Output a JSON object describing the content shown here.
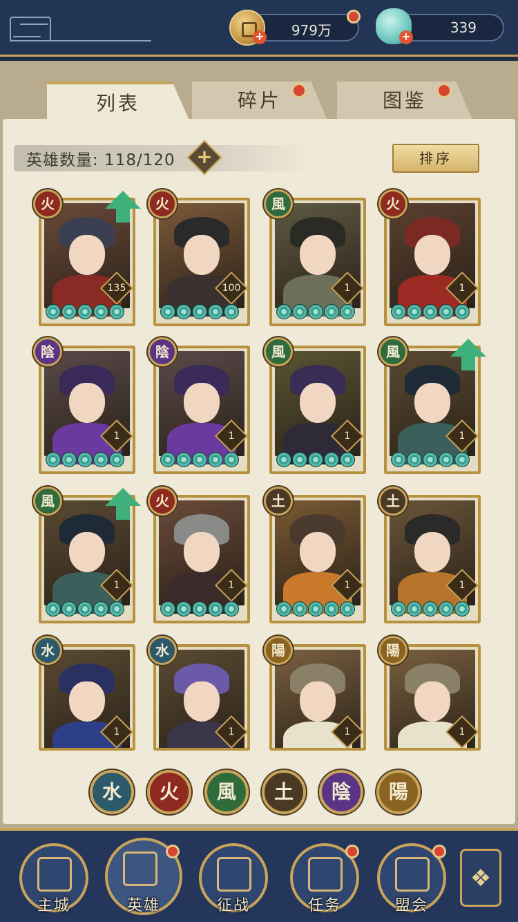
{
  "resources": {
    "coins": "979万",
    "jade": "339"
  },
  "tabs": [
    {
      "label": "列表",
      "active": true
    },
    {
      "label": "碎片",
      "active": false
    },
    {
      "label": "图鉴",
      "active": false
    }
  ],
  "hero_count": "英雄数量: 118/120",
  "add_label": "+",
  "sort_label": "排序",
  "colors": {
    "fire": "#8e2a1f",
    "wind": "#2f6b3b",
    "earth": "#4a3a24",
    "water": "#2d5a6b",
    "yin": "#5a3585",
    "yang": "#8a6321"
  },
  "heroes": [
    {
      "element": "火",
      "element_key": "fire",
      "level": "135",
      "upgradable": true,
      "hair": "#3a3f52",
      "body": "#8a2a24",
      "bg": "#6b4a3a"
    },
    {
      "element": "火",
      "element_key": "fire",
      "level": "100",
      "upgradable": false,
      "hair": "#2a2a2a",
      "body": "#3b3030",
      "bg": "#7d5a3a"
    },
    {
      "element": "風",
      "element_key": "wind",
      "level": "1",
      "upgradable": false,
      "hair": "#2b2b25",
      "body": "#6d6f58",
      "bg": "#5e5a43"
    },
    {
      "element": "火",
      "element_key": "fire",
      "level": "1",
      "upgradable": false,
      "hair": "#7a2a22",
      "body": "#9c2a24",
      "bg": "#5a4030"
    },
    {
      "element": "陰",
      "element_key": "yin",
      "level": "1",
      "upgradable": false,
      "hair": "#3a2a5a",
      "body": "#6a3aa0",
      "bg": "#5a4a4a"
    },
    {
      "element": "陰",
      "element_key": "yin",
      "level": "1",
      "upgradable": false,
      "hair": "#3a2a5a",
      "body": "#6a3aa0",
      "bg": "#5a4a4a"
    },
    {
      "element": "風",
      "element_key": "wind",
      "level": "1",
      "upgradable": false,
      "hair": "#3a2d55",
      "body": "#2e2a38",
      "bg": "#5a5533"
    },
    {
      "element": "風",
      "element_key": "wind",
      "level": "1",
      "upgradable": true,
      "hair": "#1e2a35",
      "body": "#3b5f5a",
      "bg": "#5a4a33"
    },
    {
      "element": "風",
      "element_key": "wind",
      "level": "1",
      "upgradable": true,
      "hair": "#1e2a35",
      "body": "#3b5f5a",
      "bg": "#5a4a33"
    },
    {
      "element": "火",
      "element_key": "fire",
      "level": "1",
      "upgradable": false,
      "hair": "#8a8a88",
      "body": "#3a2a2a",
      "bg": "#6a4a3a"
    },
    {
      "element": "土",
      "element_key": "earth",
      "level": "1",
      "upgradable": false,
      "hair": "#4a3a2e",
      "body": "#c87a2a",
      "bg": "#7a5a33"
    },
    {
      "element": "土",
      "element_key": "earth",
      "level": "1",
      "upgradable": false,
      "hair": "#2a2a28",
      "body": "#b8742a",
      "bg": "#6a553a"
    },
    {
      "element": "水",
      "element_key": "water",
      "level": "1",
      "upgradable": false,
      "hair": "#2a3060",
      "body": "#2e3f8a",
      "bg": "#5a4a33"
    },
    {
      "element": "水",
      "element_key": "water",
      "level": "1",
      "upgradable": false,
      "hair": "#6a5aa8",
      "body": "#3a3548",
      "bg": "#5a4a33"
    },
    {
      "element": "陽",
      "element_key": "yang",
      "level": "1",
      "upgradable": false,
      "hair": "#8a8068",
      "body": "#e8e2cc",
      "bg": "#7a6040"
    },
    {
      "element": "陽",
      "element_key": "yang",
      "level": "1",
      "upgradable": false,
      "hair": "#8a8068",
      "body": "#e8e2cc",
      "bg": "#7a6040"
    }
  ],
  "element_filters": [
    {
      "label": "水",
      "key": "water"
    },
    {
      "label": "火",
      "key": "fire"
    },
    {
      "label": "風",
      "key": "wind"
    },
    {
      "label": "土",
      "key": "earth"
    },
    {
      "label": "陰",
      "key": "yin"
    },
    {
      "label": "陽",
      "key": "yang"
    }
  ],
  "nav": [
    {
      "label": "主城",
      "icon": "city-gate-icon",
      "badge": false
    },
    {
      "label": "英雄",
      "icon": "hero-portrait-icon",
      "badge": true
    },
    {
      "label": "征战",
      "icon": "battle-helmet-icon",
      "badge": false
    },
    {
      "label": "任务",
      "icon": "quest-scroll-icon",
      "badge": true
    },
    {
      "label": "盟会",
      "icon": "guild-pavilion-icon",
      "badge": true
    }
  ],
  "menu_icon": "menu-grid-icon"
}
